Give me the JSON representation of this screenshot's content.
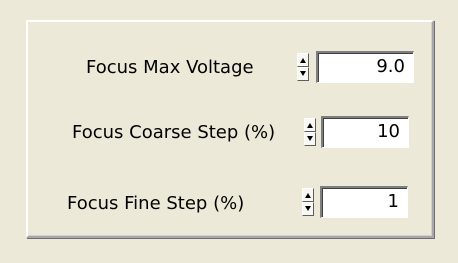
{
  "settings": {
    "focus_max_voltage": {
      "label": "Focus Max Voltage",
      "value": "9.0"
    },
    "focus_coarse_step": {
      "label": "Focus Coarse Step (%)",
      "value": "10"
    },
    "focus_fine_step": {
      "label": "Focus Fine Step (%)",
      "value": "1"
    }
  },
  "icons": {
    "spinner": "up-down-arrow-icon"
  },
  "colors": {
    "background": "#ece9d8",
    "field_background": "#ffffff"
  }
}
